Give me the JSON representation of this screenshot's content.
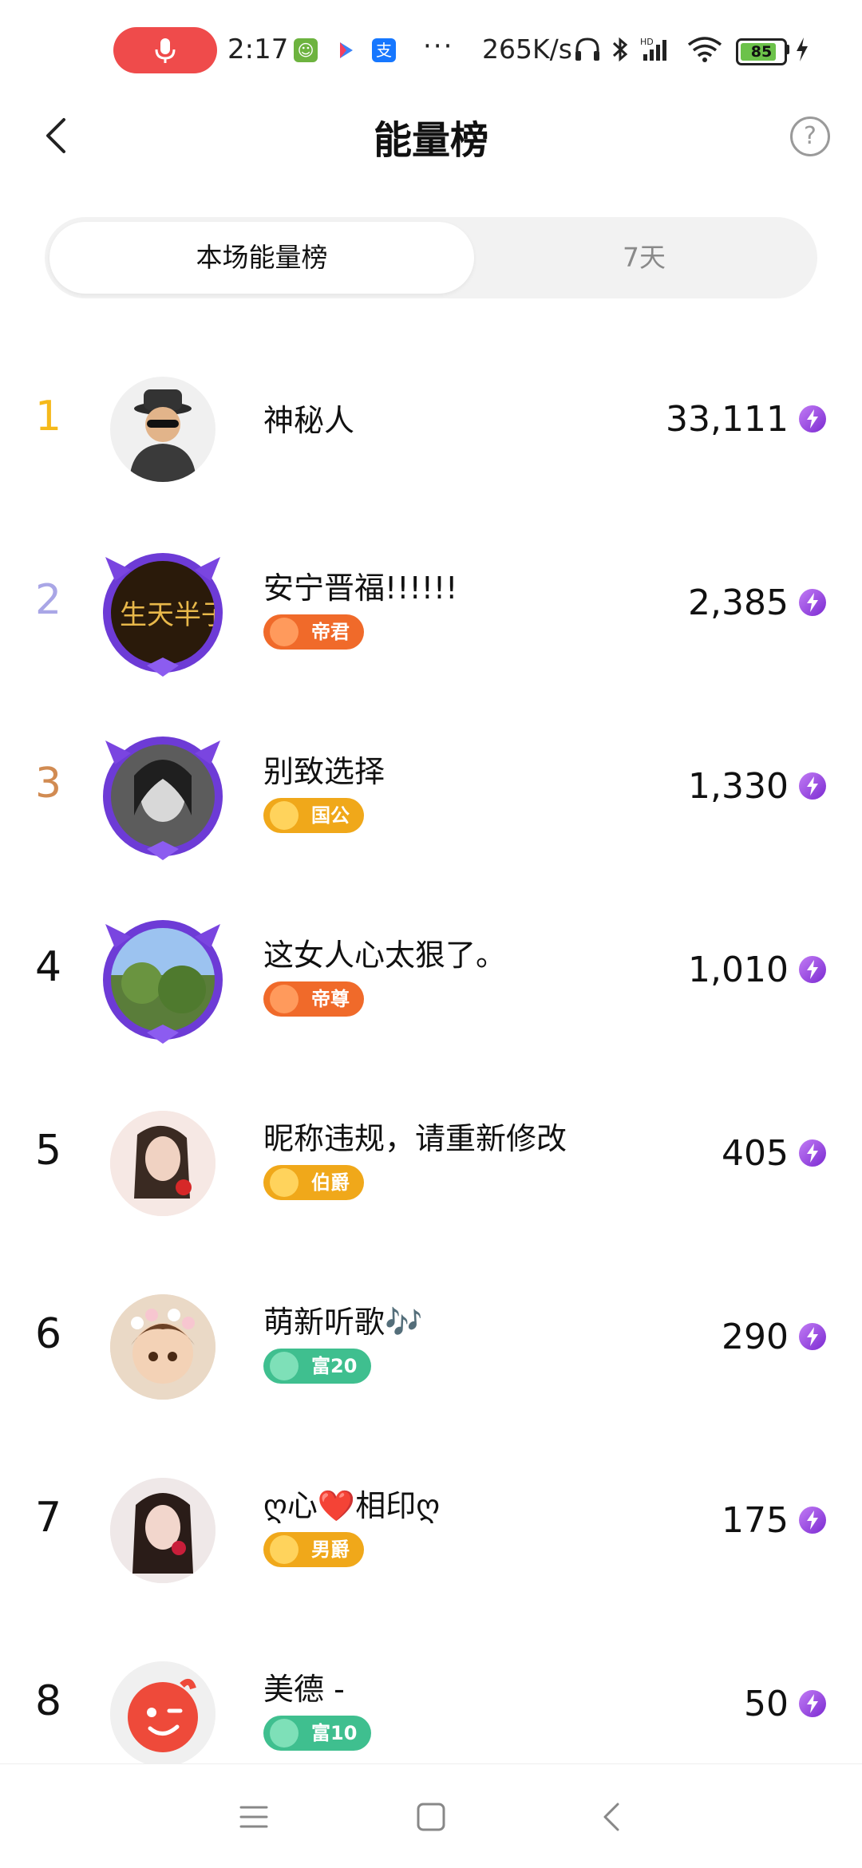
{
  "status_bar": {
    "time": "2:17",
    "network_speed": "265K/s",
    "battery_level": "85",
    "battery_fraction": 0.85,
    "apps": [
      "android-app-icon",
      "play-store-icon",
      "alipay-icon"
    ],
    "alipay_char": "支",
    "dots": "···"
  },
  "header": {
    "title": "能量榜",
    "help_symbol": "?"
  },
  "tabs": [
    {
      "label": "本场能量榜",
      "active": true
    },
    {
      "label": "7天",
      "active": false
    }
  ],
  "ranks": [
    {
      "rank": "1",
      "name": "神秘人",
      "score": "33,111",
      "rank_color": "#f5b91b",
      "badge": null
    },
    {
      "rank": "2",
      "name": "安宁晋福!!!!!!",
      "score": "2,385",
      "rank_color": "#a9a6e6",
      "badge": {
        "label": "帝君",
        "color": "#f06a2a"
      }
    },
    {
      "rank": "3",
      "name": "别致选择",
      "score": "1,330",
      "rank_color": "#d18b52",
      "badge": {
        "label": "国公",
        "color": "#f0a81a"
      }
    },
    {
      "rank": "4",
      "name": "这女人心太狠了。",
      "score": "1,010",
      "rank_color": "#111111",
      "badge": {
        "label": "帝尊",
        "color": "#f06a2a"
      }
    },
    {
      "rank": "5",
      "name": "昵称违规，请重新修改",
      "score": "405",
      "rank_color": "#111111",
      "badge": {
        "label": "伯爵",
        "color": "#f0a81a"
      }
    },
    {
      "rank": "6",
      "name": "萌新听歌🎶",
      "score": "290",
      "rank_color": "#111111",
      "badge": {
        "label": "富20",
        "color": "#3fbf8f"
      }
    },
    {
      "rank": "7",
      "name": "ღ心❤️相印ღ",
      "score": "175",
      "rank_color": "#111111",
      "badge": {
        "label": "男爵",
        "color": "#f0a81a"
      }
    },
    {
      "rank": "8",
      "name": "美德 -",
      "score": "50",
      "rank_color": "#111111",
      "badge": {
        "label": "富10",
        "color": "#3fbf8f"
      }
    }
  ]
}
